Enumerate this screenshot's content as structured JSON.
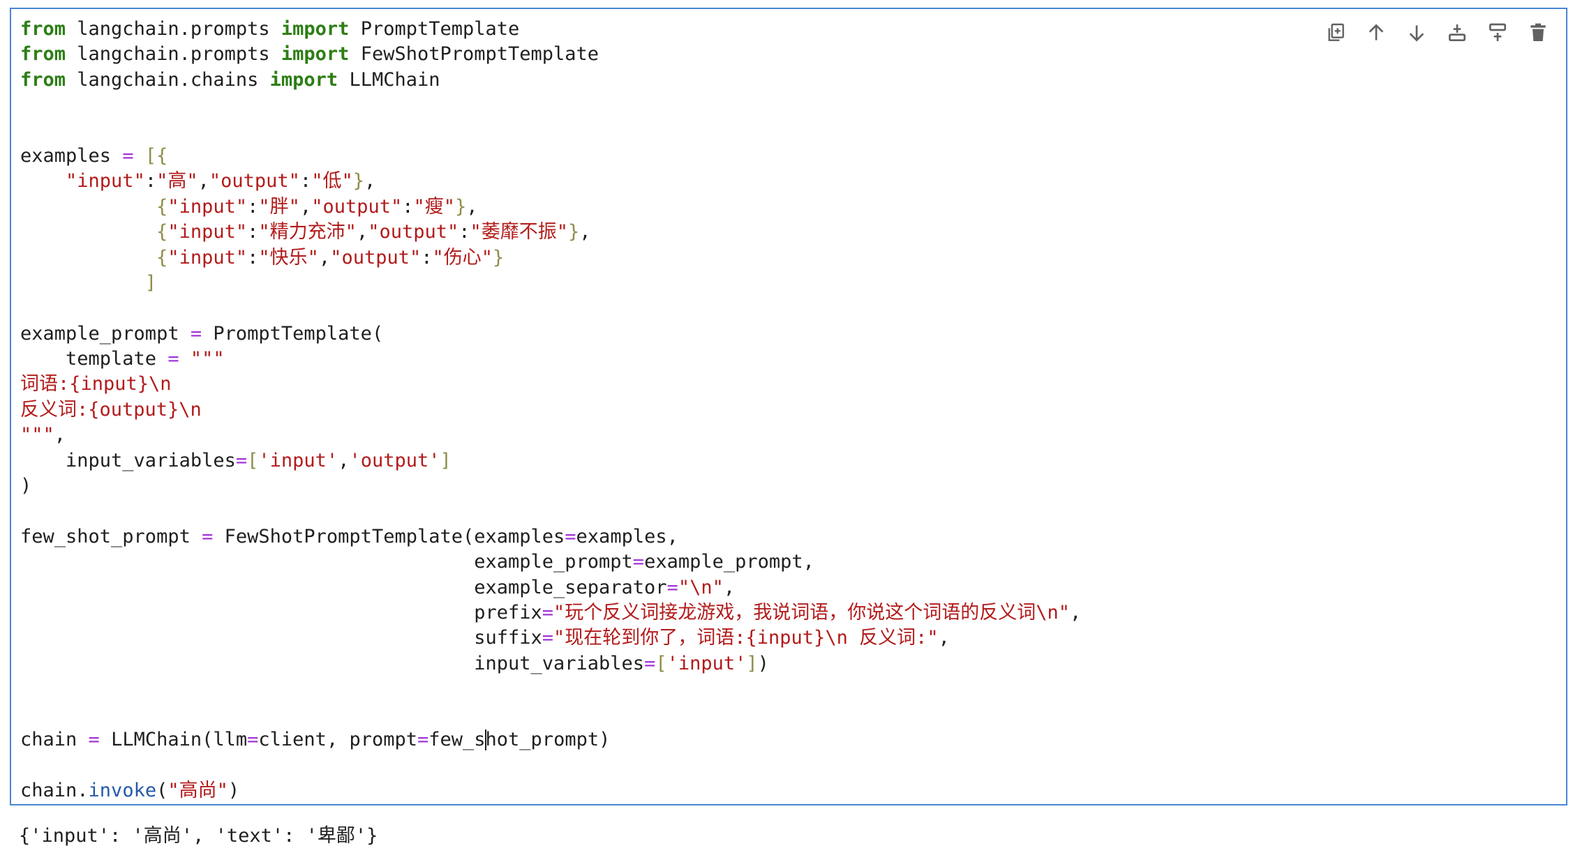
{
  "cell": {
    "lines": [
      [
        [
          "from",
          "kw"
        ],
        [
          " langchain.prompts ",
          ""
        ],
        [
          "import",
          "kw"
        ],
        [
          " PromptTemplate",
          ""
        ]
      ],
      [
        [
          "from",
          "kw"
        ],
        [
          " langchain.prompts ",
          ""
        ],
        [
          "import",
          "kw"
        ],
        [
          " FewShotPromptTemplate",
          ""
        ]
      ],
      [
        [
          "from",
          "kw"
        ],
        [
          " langchain.chains ",
          ""
        ],
        [
          "import",
          "kw"
        ],
        [
          " LLMChain",
          ""
        ]
      ],
      [],
      [],
      [
        [
          "examples ",
          ""
        ],
        [
          "=",
          "op"
        ],
        [
          " ",
          ""
        ],
        [
          "[{",
          "br"
        ]
      ],
      [
        [
          "    ",
          ""
        ],
        [
          "\"input\"",
          "str"
        ],
        [
          ":",
          ""
        ],
        [
          "\"高\"",
          "str"
        ],
        [
          ",",
          ""
        ],
        [
          "\"output\"",
          "str"
        ],
        [
          ":",
          ""
        ],
        [
          "\"低\"",
          "str"
        ],
        [
          "}",
          "br"
        ],
        [
          ",",
          ""
        ]
      ],
      [
        [
          "            ",
          ""
        ],
        [
          "{",
          "br"
        ],
        [
          "\"input\"",
          "str"
        ],
        [
          ":",
          ""
        ],
        [
          "\"胖\"",
          "str"
        ],
        [
          ",",
          ""
        ],
        [
          "\"output\"",
          "str"
        ],
        [
          ":",
          ""
        ],
        [
          "\"瘦\"",
          "str"
        ],
        [
          "}",
          "br"
        ],
        [
          ",",
          ""
        ]
      ],
      [
        [
          "            ",
          ""
        ],
        [
          "{",
          "br"
        ],
        [
          "\"input\"",
          "str"
        ],
        [
          ":",
          ""
        ],
        [
          "\"精力充沛\"",
          "str"
        ],
        [
          ",",
          ""
        ],
        [
          "\"output\"",
          "str"
        ],
        [
          ":",
          ""
        ],
        [
          "\"萎靡不振\"",
          "str"
        ],
        [
          "}",
          "br"
        ],
        [
          ",",
          ""
        ]
      ],
      [
        [
          "            ",
          ""
        ],
        [
          "{",
          "br"
        ],
        [
          "\"input\"",
          "str"
        ],
        [
          ":",
          ""
        ],
        [
          "\"快乐\"",
          "str"
        ],
        [
          ",",
          ""
        ],
        [
          "\"output\"",
          "str"
        ],
        [
          ":",
          ""
        ],
        [
          "\"伤心\"",
          "str"
        ],
        [
          "}",
          "br"
        ]
      ],
      [
        [
          "           ",
          ""
        ],
        [
          "]",
          "br"
        ]
      ],
      [],
      [
        [
          "example_prompt ",
          ""
        ],
        [
          "=",
          "op"
        ],
        [
          " PromptTemplate(",
          ""
        ]
      ],
      [
        [
          "    template ",
          ""
        ],
        [
          "=",
          "op"
        ],
        [
          " ",
          ""
        ],
        [
          "\"\"\"",
          "str"
        ]
      ],
      [
        [
          "词语:{input}\\n",
          "str"
        ]
      ],
      [
        [
          "反义词:{output}\\n",
          "str"
        ]
      ],
      [
        [
          "\"\"\"",
          "str"
        ],
        [
          ",",
          ""
        ]
      ],
      [
        [
          "    input_variables",
          ""
        ],
        [
          "=",
          "op"
        ],
        [
          "[",
          "br"
        ],
        [
          "'input'",
          "str"
        ],
        [
          ",",
          ""
        ],
        [
          "'output'",
          "str"
        ],
        [
          "]",
          "br"
        ]
      ],
      [
        [
          ")",
          ""
        ]
      ],
      [],
      [
        [
          "few_shot_prompt ",
          ""
        ],
        [
          "=",
          "op"
        ],
        [
          " FewShotPromptTemplate(examples",
          ""
        ],
        [
          "=",
          "op"
        ],
        [
          "examples,",
          ""
        ]
      ],
      [
        [
          "                                        example_prompt",
          ""
        ],
        [
          "=",
          "op"
        ],
        [
          "example_prompt,",
          ""
        ]
      ],
      [
        [
          "                                        example_separator",
          ""
        ],
        [
          "=",
          "op"
        ],
        [
          "\"\\n\"",
          "str"
        ],
        [
          ",",
          ""
        ]
      ],
      [
        [
          "                                        prefix",
          ""
        ],
        [
          "=",
          "op"
        ],
        [
          "\"玩个反义词接龙游戏，我说词语，你说这个词语的反义词\\n\"",
          "str"
        ],
        [
          ",",
          ""
        ]
      ],
      [
        [
          "                                        suffix",
          ""
        ],
        [
          "=",
          "op"
        ],
        [
          "\"现在轮到你了，词语:{input}\\n 反义词:\"",
          "str"
        ],
        [
          ",",
          ""
        ]
      ],
      [
        [
          "                                        input_variables",
          ""
        ],
        [
          "=",
          "op"
        ],
        [
          "[",
          "br"
        ],
        [
          "'input'",
          "str"
        ],
        [
          "]",
          "br"
        ],
        [
          ")",
          ""
        ]
      ],
      [],
      [],
      [
        [
          "chain ",
          ""
        ],
        [
          "=",
          "op"
        ],
        [
          " LLMChain(llm",
          ""
        ],
        [
          "=",
          "op"
        ],
        [
          "client, prompt",
          ""
        ],
        [
          "=",
          "op"
        ],
        [
          "few_s",
          ""
        ],
        [
          "|",
          "caret"
        ],
        [
          "hot_prompt)",
          ""
        ]
      ],
      [],
      [
        [
          "chain.",
          ""
        ],
        [
          "invoke",
          "fn"
        ],
        [
          "(",
          ""
        ],
        [
          "\"高尚\"",
          "str"
        ],
        [
          ")",
          ""
        ]
      ]
    ]
  },
  "toolbar": {
    "buttons": [
      {
        "name": "duplicate-cell-button",
        "icon": "copy-icon"
      },
      {
        "name": "move-up-button",
        "icon": "arrow-up-icon"
      },
      {
        "name": "move-down-button",
        "icon": "arrow-down-icon"
      },
      {
        "name": "insert-above-button",
        "icon": "insert-above-icon"
      },
      {
        "name": "insert-below-button",
        "icon": "insert-below-icon"
      },
      {
        "name": "delete-cell-button",
        "icon": "trash-icon"
      }
    ]
  },
  "output": {
    "text": "{'input': '高尚', 'text': '卑鄙'}"
  }
}
